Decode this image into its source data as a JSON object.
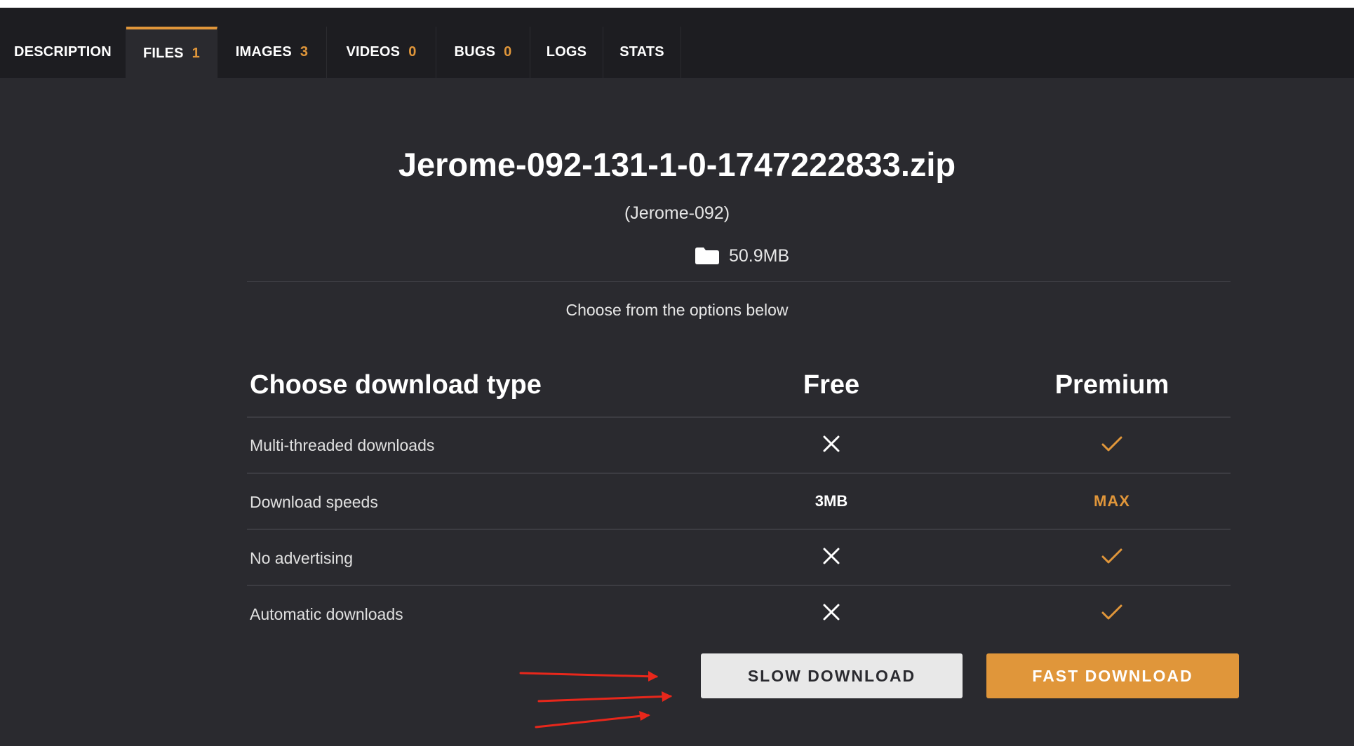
{
  "tabs": [
    {
      "label": "DESCRIPTION",
      "count": ""
    },
    {
      "label": "FILES",
      "count": "1"
    },
    {
      "label": "IMAGES",
      "count": "3"
    },
    {
      "label": "VIDEOS",
      "count": "0"
    },
    {
      "label": "BUGS",
      "count": "0"
    },
    {
      "label": "LOGS",
      "count": ""
    },
    {
      "label": "STATS",
      "count": ""
    }
  ],
  "active_tab": "FILES",
  "file": {
    "name": "Jerome-092-131-1-0-1747222833.zip",
    "subtitle": "(Jerome-092)",
    "size": "50.9MB",
    "choose_text": "Choose from the options below"
  },
  "table": {
    "header_type": "Choose download type",
    "header_free": "Free",
    "header_premium": "Premium",
    "rows": [
      {
        "label": "Multi-threaded downloads",
        "free": "x-icon",
        "premium": "check-icon"
      },
      {
        "label": "Download speeds",
        "free": "3MB",
        "premium": "MAX"
      },
      {
        "label": "No advertising",
        "free": "x-icon",
        "premium": "check-icon"
      },
      {
        "label": "Automatic downloads",
        "free": "x-icon",
        "premium": "check-icon"
      }
    ]
  },
  "buttons": {
    "slow": "SLOW DOWNLOAD",
    "fast": "FAST DOWNLOAD"
  },
  "colors": {
    "accent": "#e0963a",
    "background": "#2a2a2f",
    "tabbar": "#1d1d21",
    "annotation_arrow": "#e8271b"
  }
}
